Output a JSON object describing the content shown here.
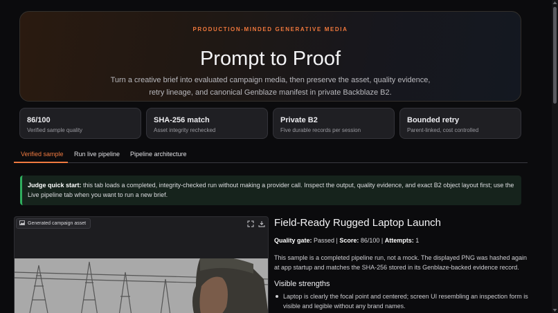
{
  "hero": {
    "eyebrow": "PRODUCTION-MINDED GENERATIVE MEDIA",
    "title": "Prompt to Proof",
    "description": "Turn a creative brief into evaluated campaign media, then preserve the asset, quality evidence, retry lineage, and canonical Genblaze manifest in private Backblaze B2."
  },
  "stats": [
    {
      "title": "86/100",
      "subtitle": "Verified sample quality"
    },
    {
      "title": "SHA-256 match",
      "subtitle": "Asset integrity rechecked"
    },
    {
      "title": "Private B2",
      "subtitle": "Five durable records per session"
    },
    {
      "title": "Bounded retry",
      "subtitle": "Parent-linked, cost controlled"
    }
  ],
  "tabs": [
    {
      "label": "Verified sample",
      "active": true
    },
    {
      "label": "Run live pipeline",
      "active": false
    },
    {
      "label": "Pipeline architecture",
      "active": false
    }
  ],
  "callout": {
    "lead": "Judge quick start:",
    "text": " this tab loads a completed, integrity-checked run without making a provider call. Inspect the output, quality evidence, and exact B2 object layout first; use the Live pipeline tab when you want to run a new brief."
  },
  "media": {
    "label": "Generated campaign asset",
    "icons": [
      "image-icon",
      "fullscreen-icon",
      "download-icon"
    ]
  },
  "detail": {
    "title": "Field-Ready Rugged Laptop Launch",
    "quality_gate_label": "Quality gate:",
    "quality_gate_value": " Passed | ",
    "score_label": "Score:",
    "score_value": " 86/100 | ",
    "attempts_label": "Attempts:",
    "attempts_value": " 1",
    "description": "This sample is a completed pipeline run, not a mock. The displayed PNG was hashed again at app startup and matches the SHA-256 stored in its Genblaze-backed evidence record.",
    "strengths_heading": "Visible strengths",
    "strengths": [
      "Laptop is clearly the focal point and centered; screen UI resembling an inspection form is visible and legible without any brand names."
    ]
  },
  "colors": {
    "accent": "#f07a40",
    "success": "#2fae5e",
    "background": "#0b0b0d"
  }
}
